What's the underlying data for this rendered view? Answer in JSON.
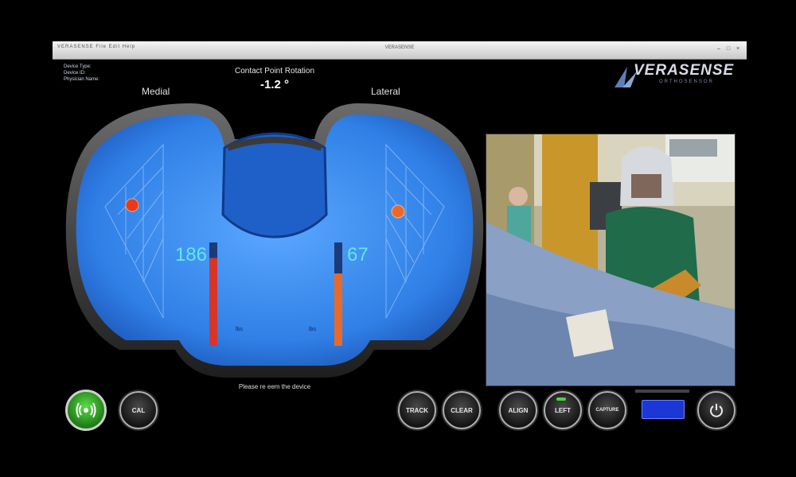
{
  "window": {
    "title": "VERASENSE",
    "menu": "VERASENSE  File  Edit  Help"
  },
  "device_info": {
    "device_type_label": "Device Type:",
    "device_type_value": "",
    "device_id_label": "Device ID:",
    "device_id_value": "",
    "physician_label": "Physician Name:",
    "physician_value": ""
  },
  "header": {
    "crp_title": "Contact Point Rotation",
    "crp_value": "-1.2 °"
  },
  "compartments": {
    "medial": {
      "label": "Medial",
      "load": "186",
      "unit": "lbs",
      "bar_level": 0.85,
      "bar_color": "#d8352a"
    },
    "lateral": {
      "label": "Lateral",
      "load": "67",
      "unit": "lbs",
      "bar_level": 0.7,
      "bar_color": "#e86a2a"
    }
  },
  "logo": {
    "brand": "VERASENSE",
    "sub": "ORTHOSENSOR"
  },
  "message": "Please re  eem the device",
  "buttons": {
    "cal": "CAL",
    "track": "TRACK",
    "clear": "CLEAR",
    "align": "ALIGN",
    "left": "LEFT",
    "capture": "CAPTURE"
  },
  "colors": {
    "tray_blue": "#2f7fe6",
    "tray_blue_light": "#5aa8ff",
    "load_text": "#5fe8e8",
    "wireless_green": "#3fc92f",
    "battery_blue": "#1b37d6"
  },
  "icons": {
    "wireless": "wireless-signal-icon",
    "power": "power-icon",
    "medial_contact": "contact-point-icon",
    "lateral_contact": "contact-point-icon"
  }
}
